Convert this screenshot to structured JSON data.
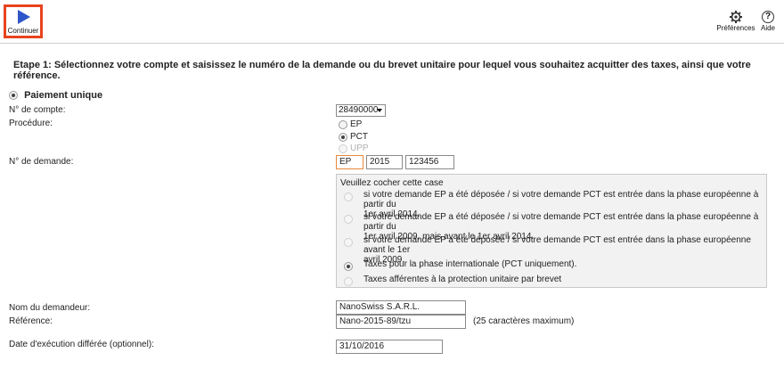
{
  "toolbar": {
    "continue_label": "Continuer",
    "preferences_label": "Préférences",
    "help_label": "Aide",
    "help_glyph": "?",
    "accent_color": "#e8431d",
    "play_color": "#2f56c9"
  },
  "step_text": "Etape 1: Sélectionnez votre compte et saisissez le numéro de la demande ou du brevet unitaire pour lequel vous souhaitez acquitter des taxes, ainsi que votre référence.",
  "payment": {
    "label": "Paiement unique",
    "selected": true
  },
  "account": {
    "label": "N° de compte:",
    "value": "28490000"
  },
  "procedure": {
    "label": "Procédure:",
    "options": [
      {
        "label": "EP",
        "selected": false,
        "disabled": false
      },
      {
        "label": "PCT",
        "selected": true,
        "disabled": false
      },
      {
        "label": "UPP",
        "selected": false,
        "disabled": true
      }
    ]
  },
  "application": {
    "label": "N° de demande:",
    "prefix": "EP",
    "year": "2015",
    "number": "123456"
  },
  "checkbox_panel": {
    "title": "Veuillez cocher cette case",
    "options": [
      {
        "line1": "si votre demande EP a été déposée / si votre demande PCT est entrée dans la phase européenne à partir du",
        "line2": "1er avril 2014.",
        "selected": false,
        "disabled": true
      },
      {
        "line1": "si votre demande EP a été déposée / si votre demande PCT est entrée dans la phase européenne à partir du",
        "line2": "1er avril 2009, mais avant le 1er avril 2014.",
        "selected": false,
        "disabled": true
      },
      {
        "line1": "si votre demande EP a été déposée / si votre demande PCT est entrée dans la phase européenne avant le 1er",
        "line2": "avril 2009.",
        "selected": false,
        "disabled": true
      },
      {
        "line1": "Taxes pour la phase internationale (PCT uniquement).",
        "line2": "",
        "selected": true,
        "disabled": false
      },
      {
        "line1": "Taxes afférentes à la protection unitaire par brevet",
        "line2": "",
        "selected": false,
        "disabled": true
      }
    ]
  },
  "applicant": {
    "label": "Nom du demandeur:",
    "value": "NanoSwiss S.A.R.L."
  },
  "reference": {
    "label": "Référence:",
    "value": "Nano-2015-89/tzu",
    "hint": "(25 caractères maximum)"
  },
  "deferred_date": {
    "label": "Date d'exécution différée (optionnel):",
    "value": "31/10/2016"
  }
}
